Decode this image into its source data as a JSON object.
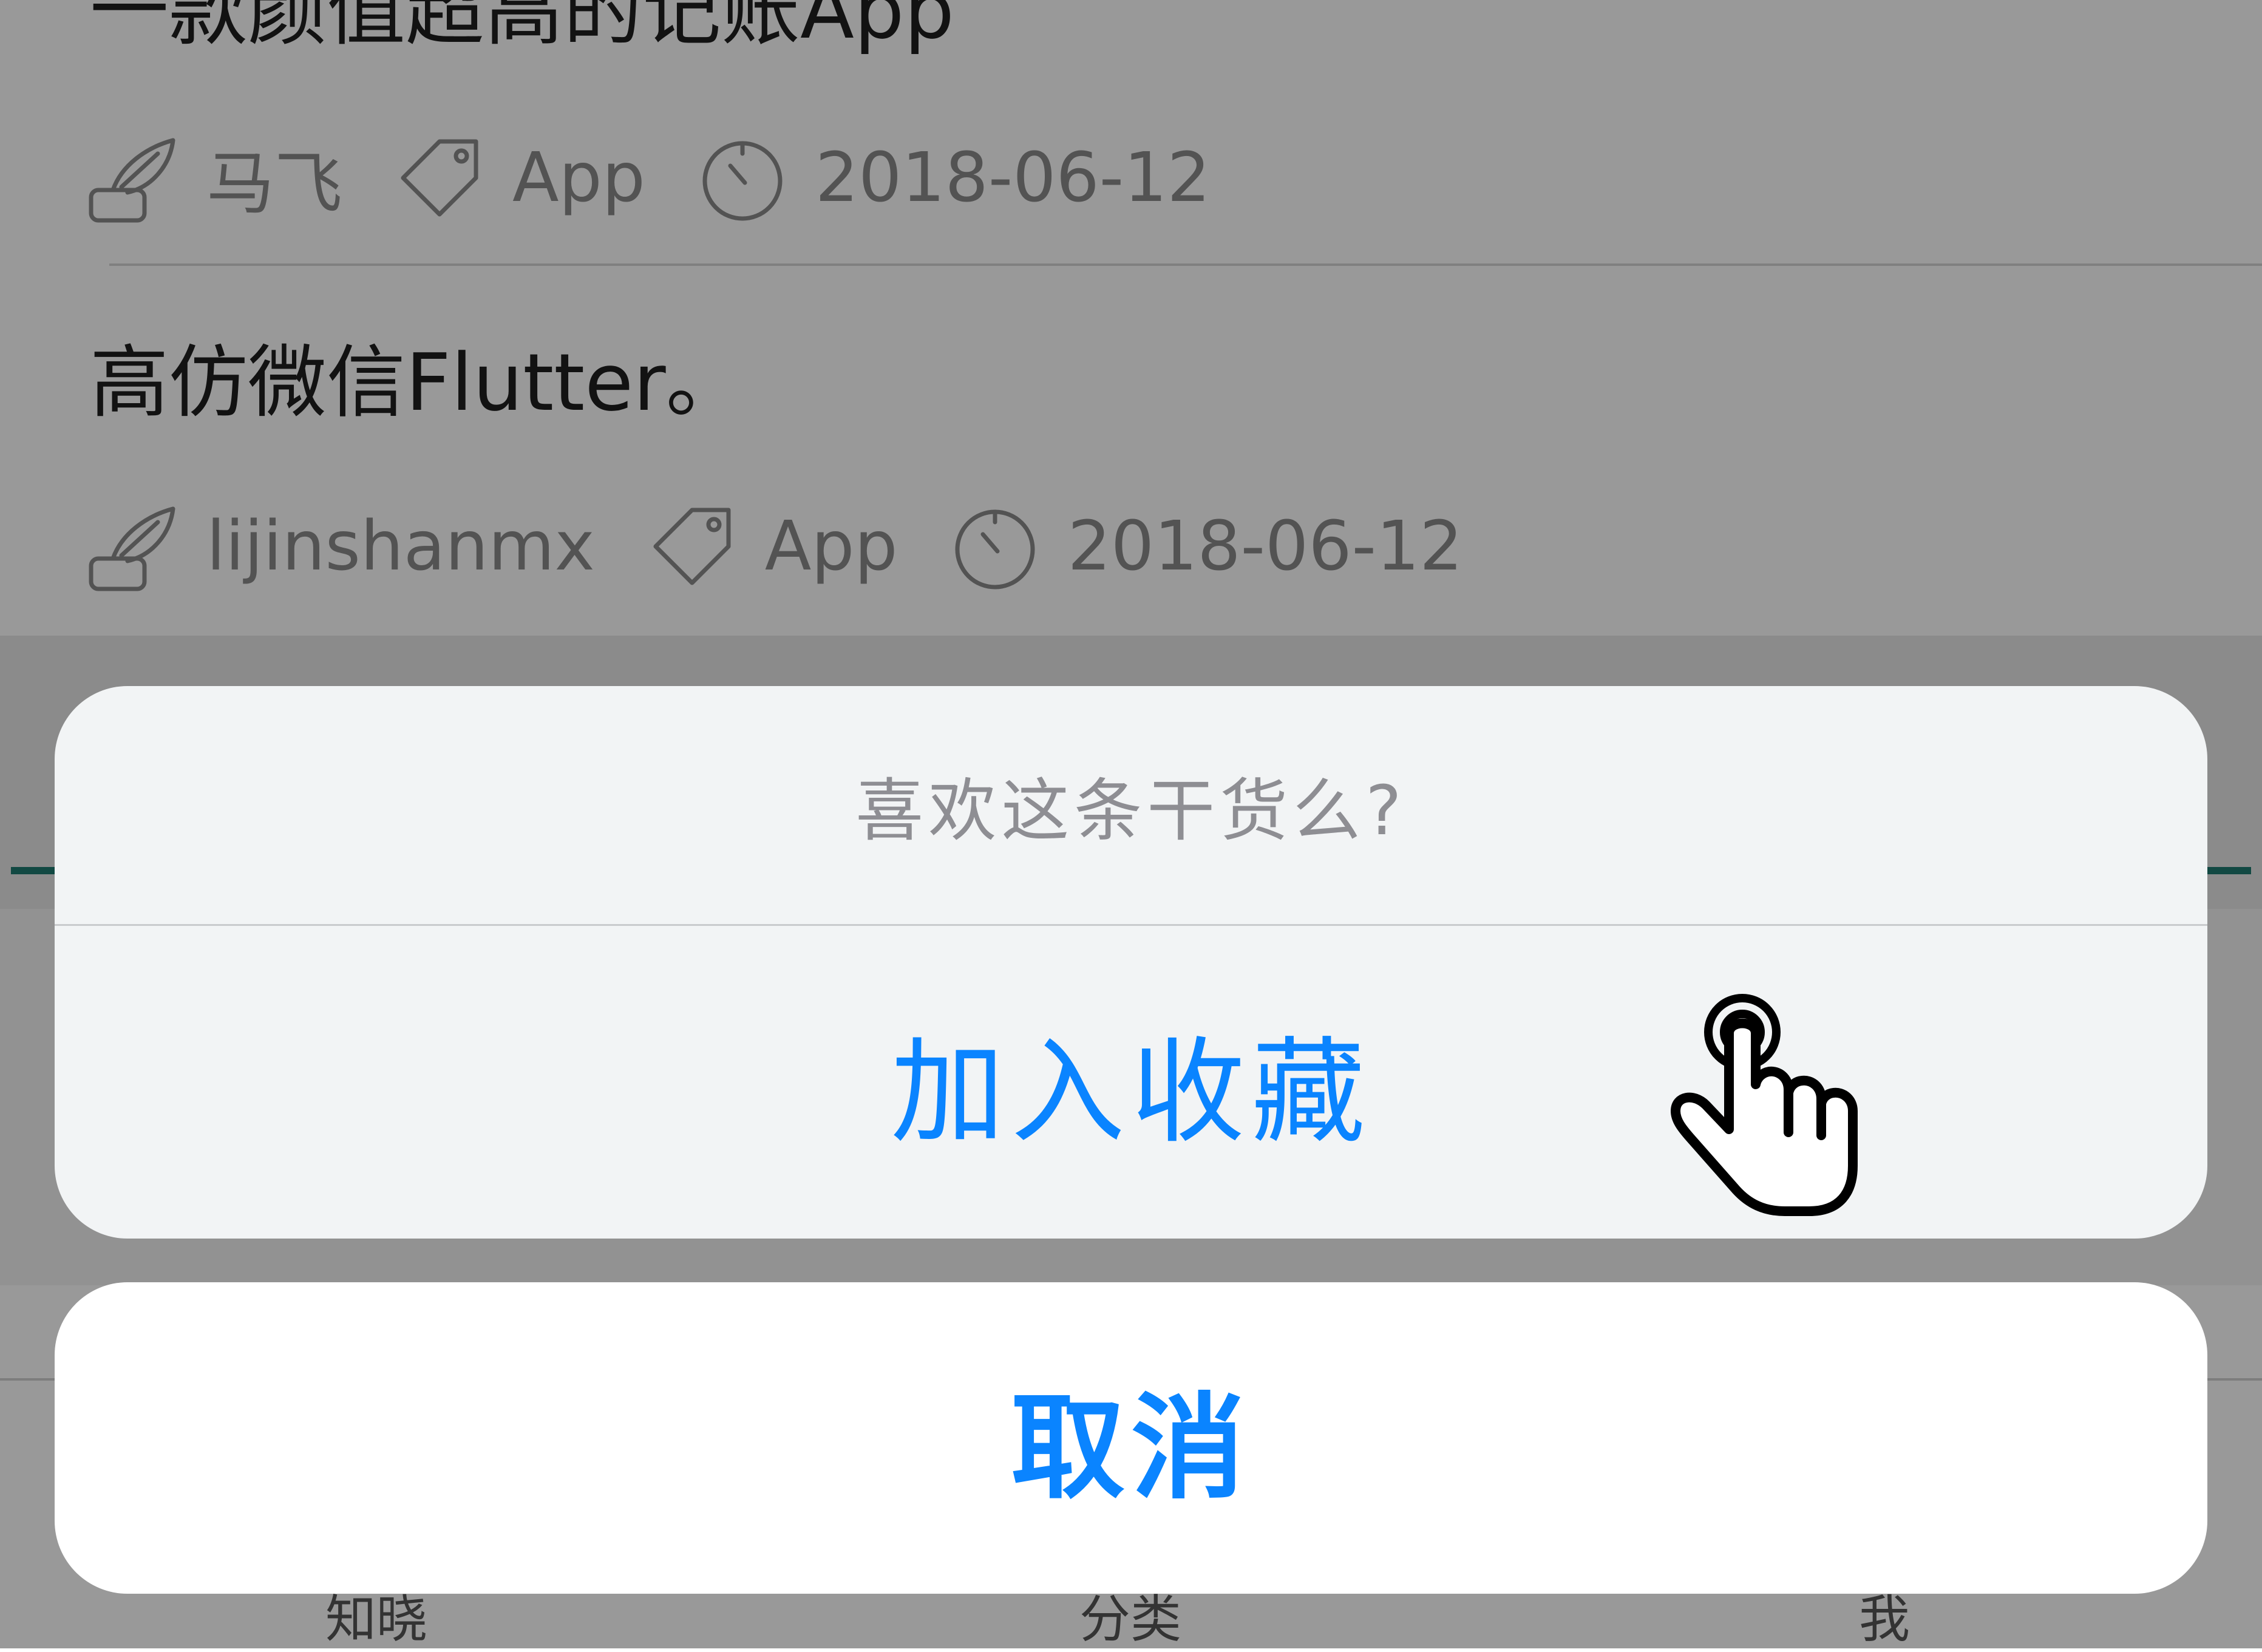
{
  "list": {
    "items": [
      {
        "title": "一款颜值超高的记账App",
        "author": "马飞",
        "category": "App",
        "date": "2018-06-12"
      },
      {
        "title": "高仿微信Flutter。",
        "author": "lijinshanmx",
        "category": "App",
        "date": "2018-06-12"
      }
    ]
  },
  "icons": {
    "author": "quill-pen-icon",
    "category": "tag-icon",
    "date": "timer-icon",
    "cursor": "tap-hand-icon"
  },
  "bottom_tabs": [
    "知晓",
    "分类",
    "我"
  ],
  "action_sheet": {
    "title": "喜欢这条干货么?",
    "action_label": "加入收藏",
    "cancel_label": "取消"
  },
  "colors": {
    "accent": "#0a84ff",
    "tab_indicator": "#1e7a70",
    "overlay": "rgba(0,0,0,0.40)"
  }
}
